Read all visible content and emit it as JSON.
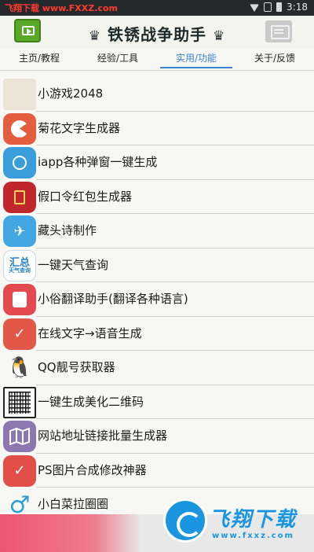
{
  "statusbar": {
    "watermark_text": "飞翔下载 www.FXXZ.com",
    "time": "3:18"
  },
  "header": {
    "crown_left": "♛",
    "title": "铁锈战争助手",
    "crown_right": "♛"
  },
  "tabs": [
    {
      "label": "主页/教程",
      "active": false
    },
    {
      "label": "经验/工具",
      "active": false
    },
    {
      "label": "实用/功能",
      "active": true
    },
    {
      "label": "关于/反馈",
      "active": false
    }
  ],
  "items": [
    {
      "label": "小游戏2048",
      "icon": "game-2048-icon"
    },
    {
      "label": "菊花文字生成器",
      "icon": "pacman-icon"
    },
    {
      "label": "iapp各种弹窗一键生成",
      "icon": "touch-hand-icon"
    },
    {
      "label": "假口令红包生成器",
      "icon": "red-envelope-icon"
    },
    {
      "label": "藏头诗制作",
      "icon": "paper-plane-icon"
    },
    {
      "label": "一键天气查询",
      "icon": "weather-icon"
    },
    {
      "label": "小俗翻译助手(翻译各种语言)",
      "icon": "message-icon"
    },
    {
      "label": "在线文字→语音生成",
      "icon": "check-circle-icon"
    },
    {
      "label": "QQ靓号获取器",
      "icon": "qq-penguin-icon"
    },
    {
      "label": "一键生成美化二维码",
      "icon": "qr-code-icon"
    },
    {
      "label": "网站地址链接批量生成器",
      "icon": "map-icon"
    },
    {
      "label": "PS图片合成修改神器",
      "icon": "check-circle-icon"
    },
    {
      "label": "小白菜拉圈圈",
      "icon": "male-symbol-icon"
    }
  ],
  "icon_glyphs": {
    "weather_text": "汇总",
    "weather_sub": "天气查询"
  },
  "footer_watermark": {
    "brand": "飞翔下载",
    "url": "www.fxxz.com"
  },
  "colors": {
    "accent": "#3b84cf",
    "header_green": "#5aa828",
    "watermark_blue": "#1a96e0"
  }
}
